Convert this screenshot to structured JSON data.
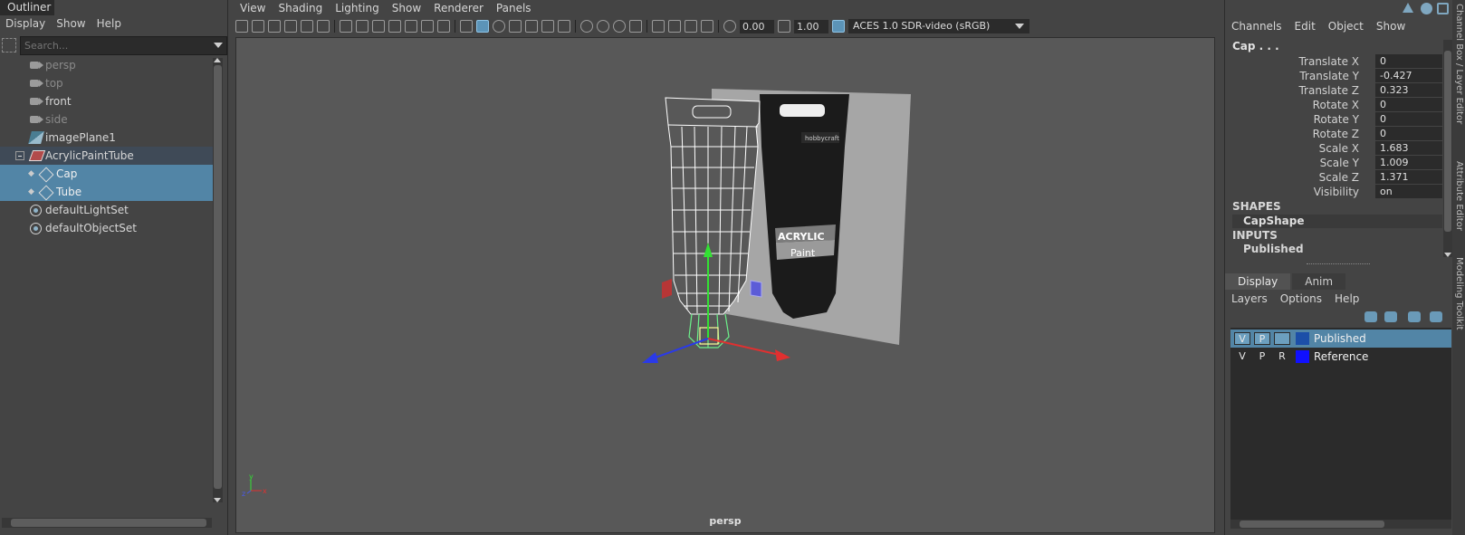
{
  "outliner": {
    "title": "Outliner",
    "menu": [
      "Display",
      "Show",
      "Help"
    ],
    "search_placeholder": "Search...",
    "items": [
      {
        "label": "persp",
        "icon": "camera-icon",
        "dim": true
      },
      {
        "label": "top",
        "icon": "camera-icon",
        "dim": true
      },
      {
        "label": "front",
        "icon": "camera-icon",
        "dim": false
      },
      {
        "label": "side",
        "icon": "camera-icon",
        "dim": true
      },
      {
        "label": "imagePlane1",
        "icon": "image-plane-icon",
        "dim": false
      },
      {
        "label": "AcrylicPaintTube",
        "icon": "group-icon",
        "dim": false
      },
      {
        "label": "Cap",
        "icon": "mesh-icon",
        "selected": true
      },
      {
        "label": "Tube",
        "icon": "mesh-icon",
        "selected": true
      },
      {
        "label": "defaultLightSet",
        "icon": "set-icon",
        "dim": false
      },
      {
        "label": "defaultObjectSet",
        "icon": "set-icon",
        "dim": false
      }
    ]
  },
  "viewport": {
    "menu": [
      "View",
      "Shading",
      "Lighting",
      "Show",
      "Renderer",
      "Panels"
    ],
    "exposure": "0.00",
    "gamma": "1.00",
    "color_space": "ACES 1.0 SDR-video (sRGB)",
    "camera": "persp",
    "tube_brand": "hobbycraft",
    "tube_label_1": "ACRYLIC",
    "tube_label_2": "Paint"
  },
  "channelbox": {
    "menu": [
      "Channels",
      "Edit",
      "Object",
      "Show"
    ],
    "object_name": "Cap . . .",
    "attributes": [
      {
        "name": "Translate X",
        "value": "0"
      },
      {
        "name": "Translate Y",
        "value": "-0.427"
      },
      {
        "name": "Translate Z",
        "value": "0.323"
      },
      {
        "name": "Rotate X",
        "value": "0"
      },
      {
        "name": "Rotate Y",
        "value": "0"
      },
      {
        "name": "Rotate Z",
        "value": "0"
      },
      {
        "name": "Scale X",
        "value": "1.683"
      },
      {
        "name": "Scale Y",
        "value": "1.009"
      },
      {
        "name": "Scale Z",
        "value": "1.371"
      },
      {
        "name": "Visibility",
        "value": "on"
      }
    ],
    "shapes_header": "SHAPES",
    "shape_name": "CapShape",
    "inputs_header": "INPUTS",
    "input_name": "Published",
    "side_tabs": [
      "Channel Box / Layer Editor",
      "Attribute Editor",
      "Modeling Toolkit"
    ]
  },
  "layers": {
    "tabs": [
      "Display",
      "Anim"
    ],
    "menu": [
      "Layers",
      "Options",
      "Help"
    ],
    "rows": [
      {
        "v": "V",
        "p": "P",
        "r": "",
        "color": "#1c4fa8",
        "name": "Published",
        "selected": true
      },
      {
        "v": "V",
        "p": "P",
        "r": "R",
        "color": "#1010ff",
        "name": "Reference",
        "selected": false
      }
    ]
  },
  "colors": {
    "selection": "#5285a6",
    "panel_bg": "#444444",
    "viewport_bg": "#585858",
    "field_bg": "#2b2b2b"
  }
}
